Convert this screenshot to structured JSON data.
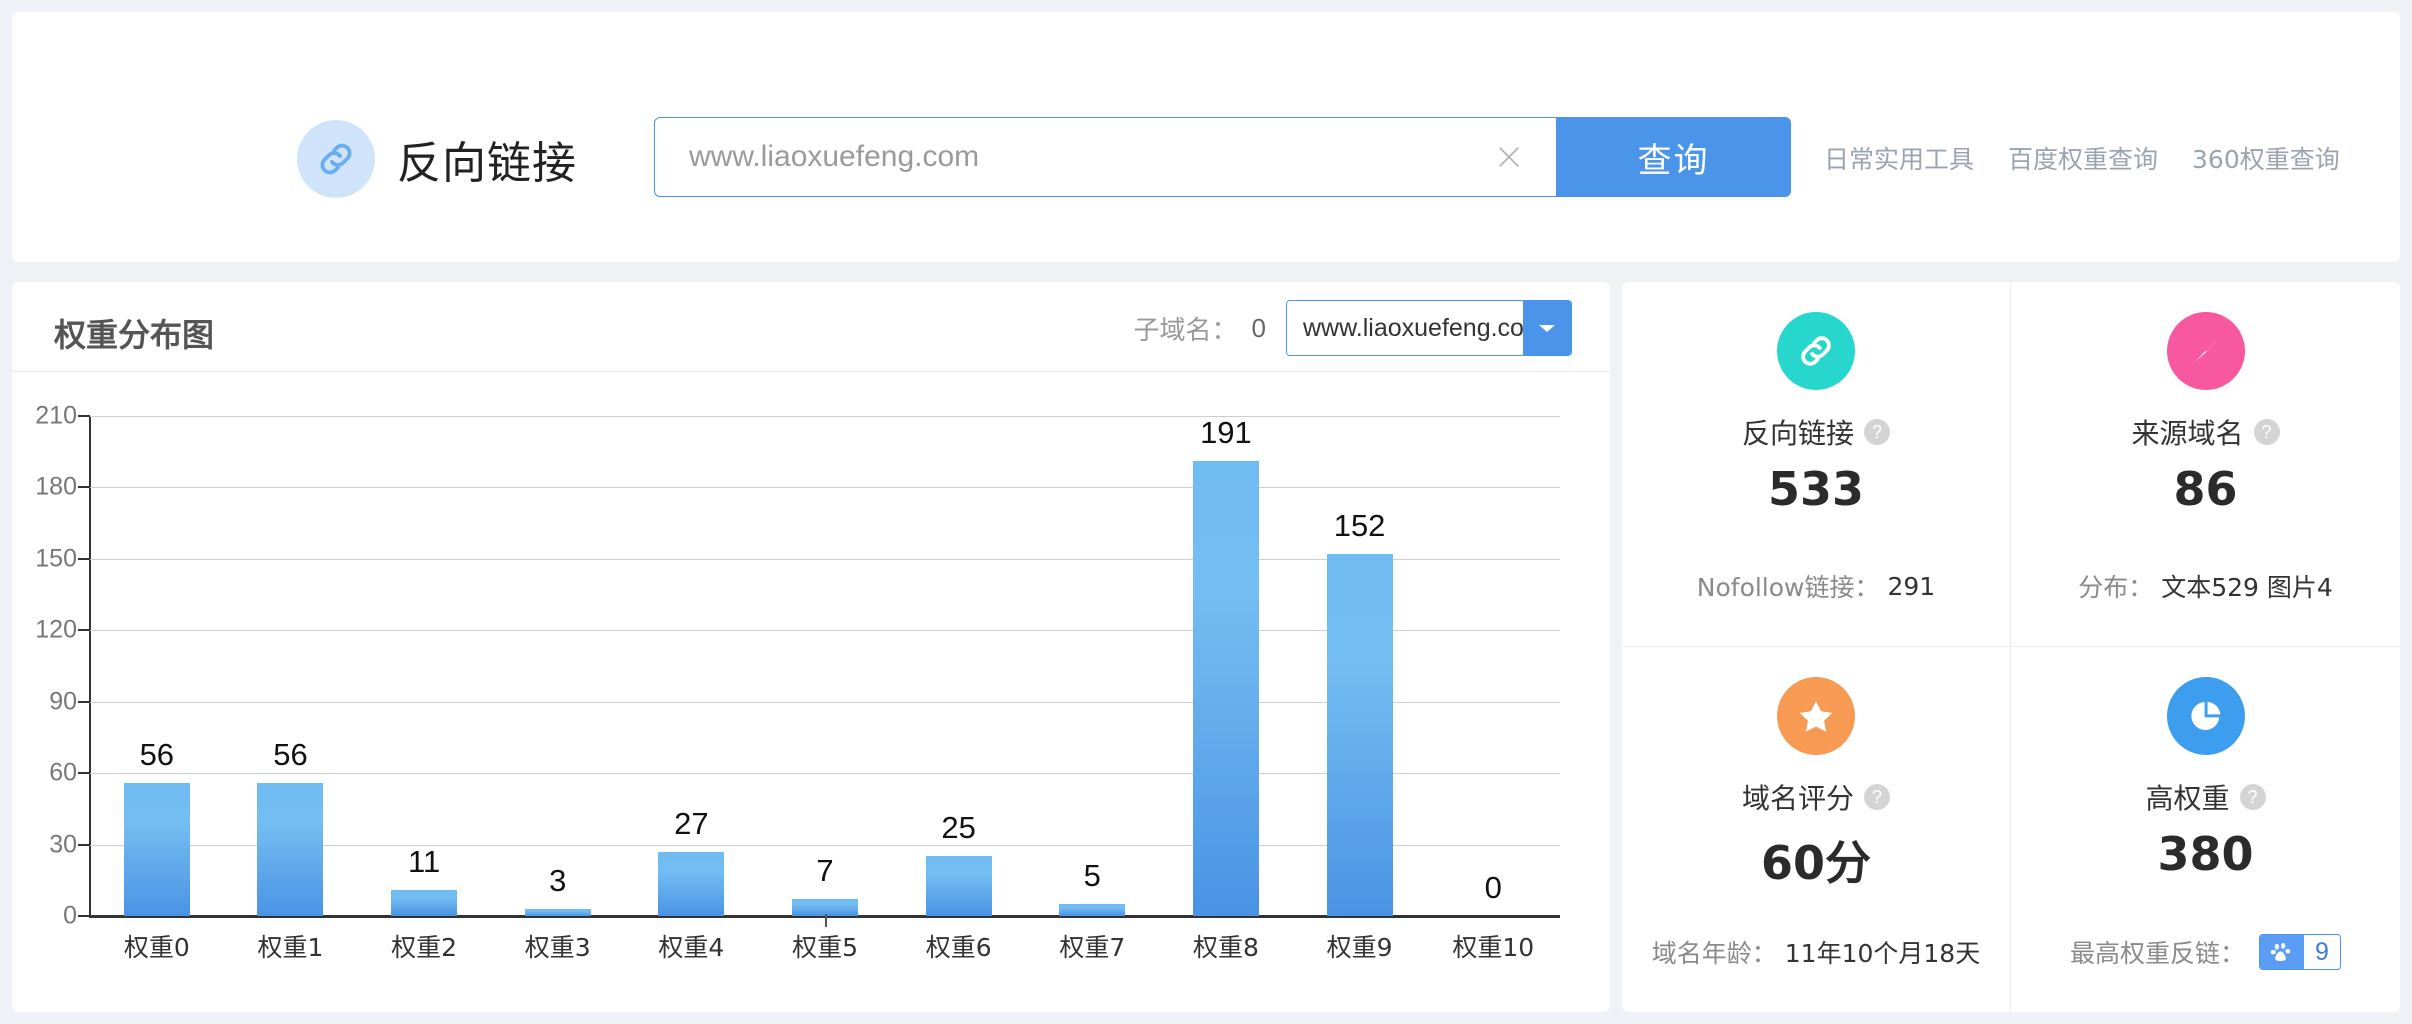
{
  "header": {
    "brand_title": "反向链接",
    "logo_icon": "chain-link-icon",
    "search_placeholder": "www.liaoxuefeng.com",
    "search_value": "",
    "search_button": "查询",
    "clear_icon": "close-icon",
    "nav_links": [
      "日常实用工具",
      "百度权重查询",
      "360权重查询"
    ]
  },
  "chart_panel": {
    "title": "权重分布图",
    "subdomain_label": "子域名：",
    "subdomain_count": "0",
    "selected_domain": "www.liaoxuefeng.com",
    "dropdown_icon": "chevron-down-icon"
  },
  "chart_data": {
    "type": "bar",
    "title": "权重分布图",
    "categories": [
      "权重0",
      "权重1",
      "权重2",
      "权重3",
      "权重4",
      "权重5",
      "权重6",
      "权重7",
      "权重8",
      "权重9",
      "权重10"
    ],
    "values": [
      56,
      56,
      11,
      3,
      27,
      7,
      25,
      5,
      191,
      152,
      0
    ],
    "yticks": [
      0,
      30,
      60,
      90,
      120,
      150,
      180,
      210
    ],
    "ylim": [
      0,
      210
    ],
    "xlabel": "",
    "ylabel": "",
    "grid": true,
    "legend": false,
    "bar_color_top": "#6fbcf2",
    "bar_color_bottom": "#4a93e4"
  },
  "stats": [
    {
      "icon": "chain-link-icon",
      "icon_bg": "#27d7ce",
      "label": "反向链接",
      "help": "?",
      "value": "533",
      "sub_label": "Nofollow链接：",
      "sub_value": "291"
    },
    {
      "icon": "compass-navigate-icon",
      "icon_bg": "#f8589f",
      "label": "来源域名",
      "help": "?",
      "value": "86",
      "sub_label": "分布：",
      "sub_value": "文本529 图片4"
    },
    {
      "icon": "star-icon",
      "icon_bg": "#f79b54",
      "label": "域名评分",
      "help": "?",
      "value": "60分",
      "sub_label": "域名年龄：",
      "sub_value": "11年10个月18天"
    },
    {
      "icon": "pie-chart-icon",
      "icon_bg": "#3d9ef0",
      "label": "高权重",
      "help": "?",
      "value": "380",
      "sub_label": "最高权重反链：",
      "sub_value": "",
      "badge_icon": "baidu-paw-icon",
      "badge_value": "9"
    }
  ],
  "colors": {
    "accent": "#4a94ea",
    "page_bg": "#eef2f7",
    "card_bg": "#ffffff"
  }
}
